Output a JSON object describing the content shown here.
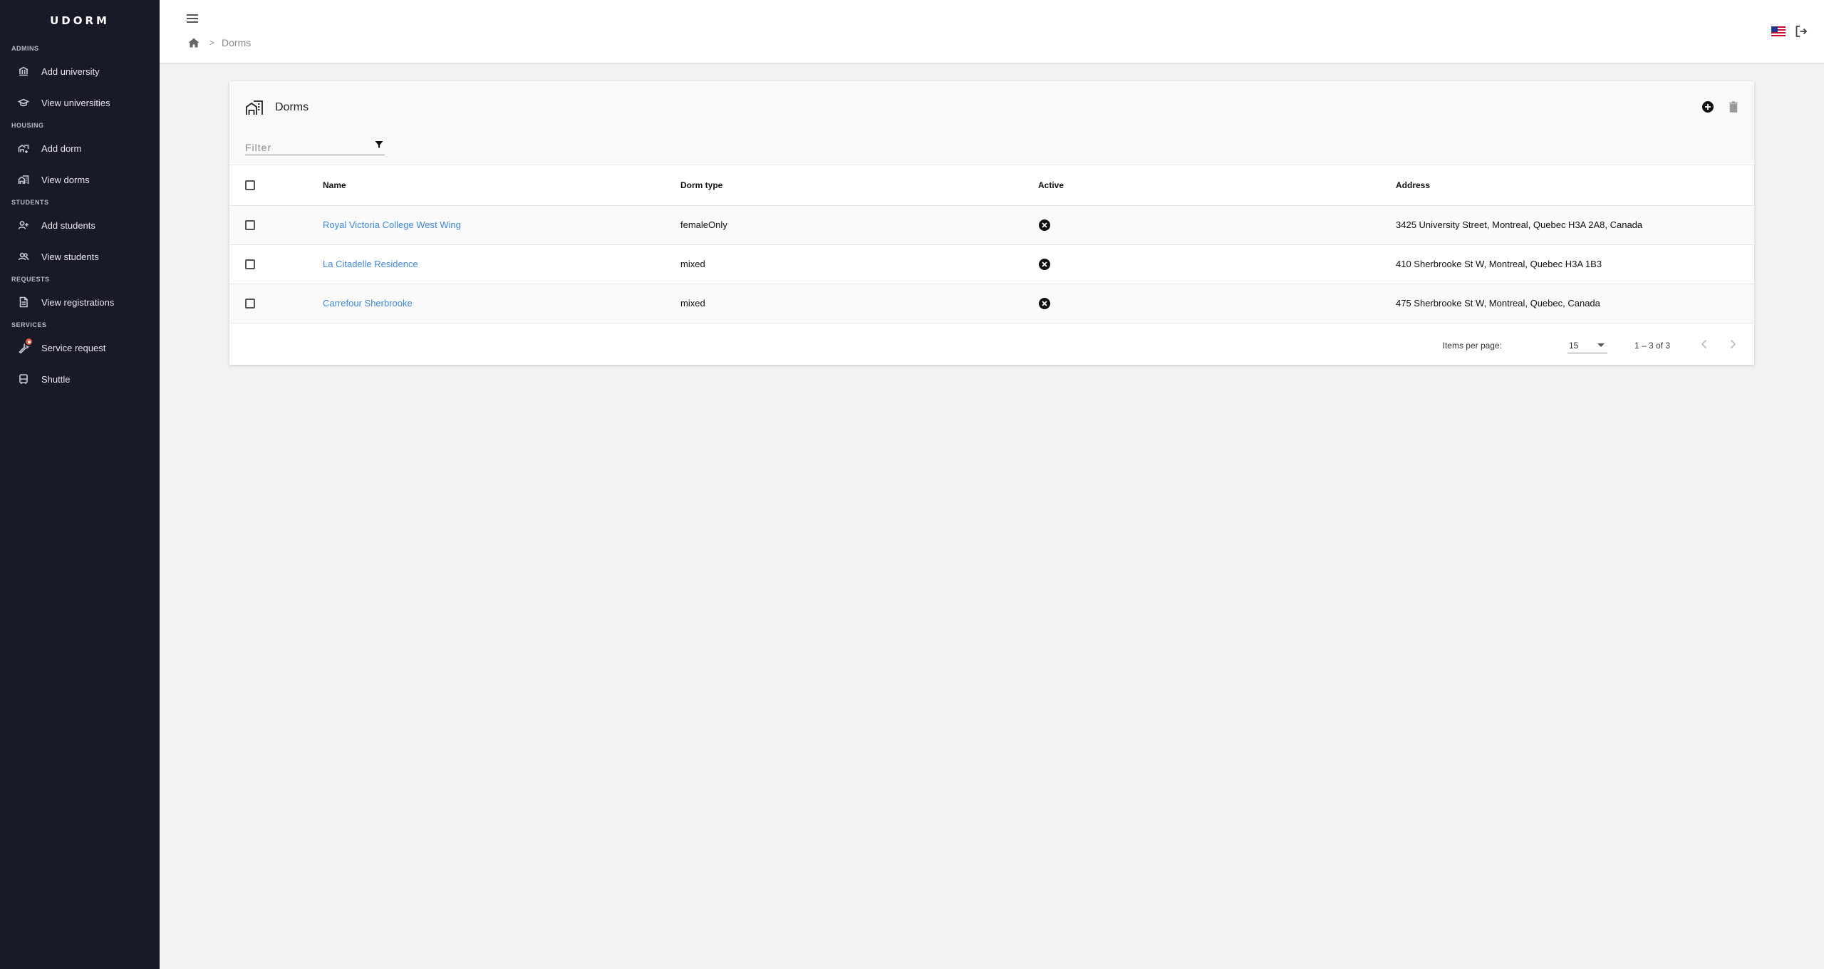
{
  "app": {
    "brand": "UDORM"
  },
  "sidebar": {
    "sections": [
      {
        "title": "ADMINS",
        "items": [
          {
            "label": "Add university",
            "icon": "bank-icon"
          },
          {
            "label": "View universities",
            "icon": "graduation-cap-icon"
          }
        ]
      },
      {
        "title": "HOUSING",
        "items": [
          {
            "label": "Add dorm",
            "icon": "add-building-icon"
          },
          {
            "label": "View dorms",
            "icon": "buildings-icon"
          }
        ]
      },
      {
        "title": "STUDENTS",
        "items": [
          {
            "label": "Add students",
            "icon": "add-user-icon"
          },
          {
            "label": "View students",
            "icon": "users-icon"
          }
        ]
      },
      {
        "title": "REQUESTS",
        "items": [
          {
            "label": "View registrations",
            "icon": "document-icon"
          }
        ]
      },
      {
        "title": "SERVICES",
        "items": [
          {
            "label": "Service request",
            "icon": "wrench-icon"
          },
          {
            "label": "Shuttle",
            "icon": "bus-icon"
          }
        ]
      }
    ]
  },
  "header": {
    "breadcrumb": {
      "separator": ">",
      "current": "Dorms"
    },
    "language_icon": "us-flag-icon",
    "logout_icon": "logout-icon"
  },
  "card": {
    "title": "Dorms",
    "filter_placeholder": "Filter",
    "table": {
      "columns": [
        "Name",
        "Dorm type",
        "Active",
        "Address"
      ],
      "rows": [
        {
          "name": "Royal Victoria College West Wing",
          "type": "femaleOnly",
          "active": false,
          "address": "3425 University Street, Montreal, Quebec H3A 2A8, Canada"
        },
        {
          "name": "La Citadelle Residence",
          "type": "mixed",
          "active": false,
          "address": "410 Sherbrooke St W, Montreal, Quebec H3A 1B3"
        },
        {
          "name": "Carrefour Sherbrooke",
          "type": "mixed",
          "active": false,
          "address": "475 Sherbrooke St W, Montreal, Quebec, Canada"
        }
      ]
    },
    "paginator": {
      "items_per_page_label": "Items per page:",
      "items_per_page": "15",
      "range": "1 – 3 of 3"
    }
  },
  "colors": {
    "sidebar_bg": "#181a28",
    "link": "#3f87d8",
    "badge": "#e8553b"
  }
}
